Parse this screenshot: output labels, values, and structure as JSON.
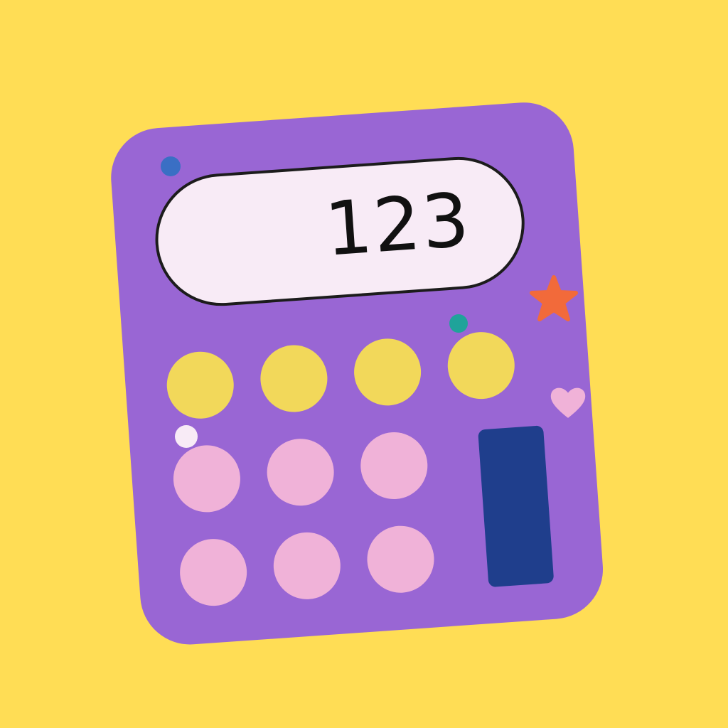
{
  "display": {
    "value": "123"
  },
  "colors": {
    "background": "#FFDD55",
    "body": "#9966D4",
    "display_bg": "#F8EBF6",
    "display_border": "#1C1C1C",
    "top_keys": "#F2D85A",
    "number_keys": "#F0B2D8",
    "enter_key": "#1F3E8C",
    "star": "#F26A3A",
    "heart": "#F0B2D8",
    "dot_blue": "#3A6FC4",
    "dot_teal": "#1FA39A",
    "dot_white": "#F8EBF6"
  },
  "keys": {
    "top_row": [
      "",
      "",
      "",
      ""
    ],
    "number_rows": [
      [
        "",
        "",
        ""
      ],
      [
        "",
        "",
        ""
      ]
    ]
  },
  "icons": {
    "star": "star-icon",
    "heart": "heart-icon"
  }
}
